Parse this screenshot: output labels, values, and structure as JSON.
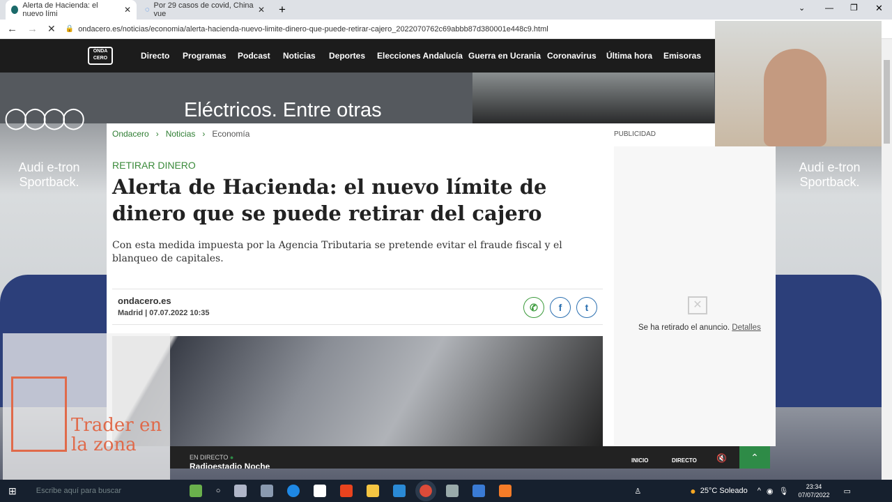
{
  "browser": {
    "tabs": [
      {
        "title": "Alerta de Hacienda: el nuevo lími",
        "active": true
      },
      {
        "title": "Por 29 casos de covid, China vue",
        "active": false
      }
    ],
    "url": "ondacero.es/noticias/economia/alerta-hacienda-nuevo-limite-dinero-que-puede-retirar-cajero_2022070762c69abbb87d380001e448c9.html"
  },
  "site": {
    "logo": "ONDA CERO",
    "nav": [
      "Directo",
      "Programas",
      "Podcast",
      "Noticias",
      "Deportes",
      "Elecciones Andalucía",
      "Guerra en Ucrania",
      "Coronavirus",
      "Última hora",
      "Emisoras"
    ]
  },
  "ad": {
    "banner": "Eléctricos. Entre otras",
    "left": "Audi e-tron Sportback.",
    "right": "Audi e-tron Sportback."
  },
  "article": {
    "breadcrumb": [
      "Ondacero",
      "Noticias",
      "Economía"
    ],
    "kicker": "RETIRAR DINERO",
    "title": "Alerta de Hacienda: el nuevo límite de dinero que se puede retirar del cajero",
    "subtitle": "Con esta medida impuesta por la Agencia Tributaria se pretende evitar el fraude fiscal y el blanqueo de capitales.",
    "source": "ondacero.es",
    "location": "Madrid",
    "date": "07.07.2022 10:35"
  },
  "sidebar": {
    "label": "PUBLICIDAD",
    "removed": "Se ha retirado el anuncio.",
    "details": "Detalles"
  },
  "player": {
    "live": "EN DIRECTO",
    "program": "Radioestadio Noche",
    "start": "INICIO",
    "direct": "DIRECTO"
  },
  "watermark": "Trader en la zona",
  "taskbar": {
    "search": "Escribe aquí para buscar",
    "weather": "25°C  Soleado",
    "time": "23:34",
    "date": "07/07/2022"
  },
  "colors": {
    "kicker": "#3a8a3a",
    "nav": "#1c1c1c",
    "share": "#2a6fb0",
    "playerGreen": "#2e8b47"
  }
}
